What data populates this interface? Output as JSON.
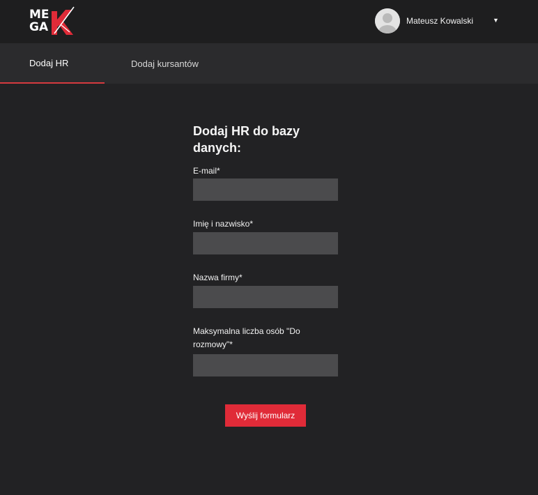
{
  "brand": {
    "logo_line1": "ME",
    "logo_line2": "GA",
    "logo_letter": "K",
    "logo_accent_color": "#e02b38"
  },
  "header": {
    "user_name": "Mateusz Kowalski",
    "dropdown_icon": "caret-down-icon",
    "dropdown_glyph": "▼",
    "avatar_icon": "user-avatar-icon"
  },
  "tabs": [
    {
      "label": "Dodaj HR",
      "active": true
    },
    {
      "label": "Dodaj kursantów",
      "active": false
    }
  ],
  "form": {
    "title": "Dodaj HR do bazy danych:",
    "fields": [
      {
        "label": "E-mail*",
        "value": ""
      },
      {
        "label": "Imię i nazwisko*",
        "value": ""
      },
      {
        "label": "Nazwa firmy*",
        "value": ""
      },
      {
        "label": "Maksymalna liczba osób \"Do rozmowy\"*",
        "value": ""
      }
    ],
    "submit_label": "Wyślij formularz"
  },
  "colors": {
    "background": "#222224",
    "topbar": "#1e1e1f",
    "tabbar": "#2b2b2d",
    "input": "#4b4b4d",
    "accent": "#e02b38"
  }
}
